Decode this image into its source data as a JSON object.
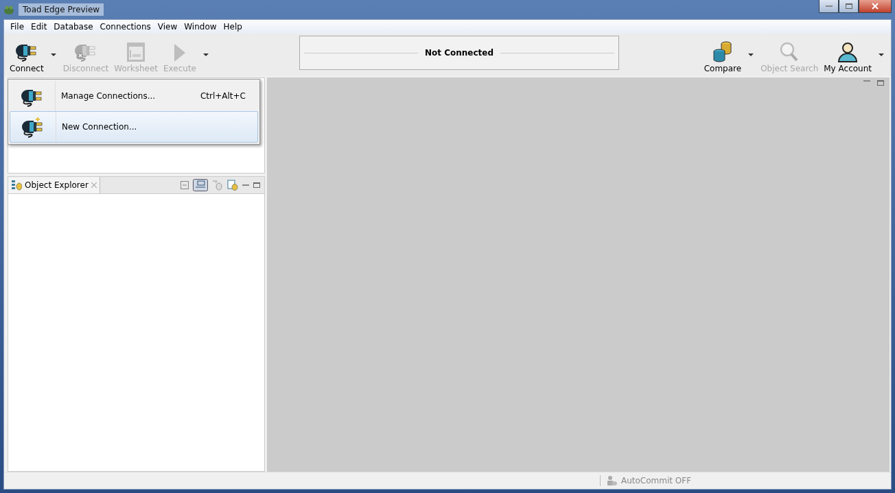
{
  "window": {
    "title": "Toad Edge Preview"
  },
  "menu_bar": [
    "File",
    "Edit",
    "Database",
    "Connections",
    "View",
    "Window",
    "Help"
  ],
  "toolbar": {
    "left": [
      {
        "kind": "connect",
        "label": "Connect",
        "disabled": false,
        "dropdown": true
      },
      {
        "kind": "disconnect",
        "label": "Disconnect",
        "disabled": true,
        "dropdown": false
      },
      {
        "kind": "worksheet",
        "label": "Worksheet",
        "disabled": true,
        "dropdown": false
      },
      {
        "kind": "execute",
        "label": "Execute",
        "disabled": true,
        "dropdown": true
      }
    ],
    "connection_status": "Not Connected",
    "right": [
      {
        "kind": "compare",
        "label": "Compare",
        "disabled": false,
        "dropdown": true
      },
      {
        "kind": "search",
        "label": "Object Search",
        "disabled": true,
        "dropdown": false
      },
      {
        "kind": "account",
        "label": "My Account",
        "disabled": false,
        "dropdown": true
      }
    ]
  },
  "connect_menu": [
    {
      "kind": "manage",
      "label": "Manage Connections...",
      "shortcut": "Ctrl+Alt+C",
      "selected": false
    },
    {
      "kind": "new",
      "label": "New Connection...",
      "selected": true
    }
  ],
  "object_explorer": {
    "tab": "Object Explorer"
  },
  "status_bar": {
    "autocommit": "AutoCommit OFF"
  }
}
